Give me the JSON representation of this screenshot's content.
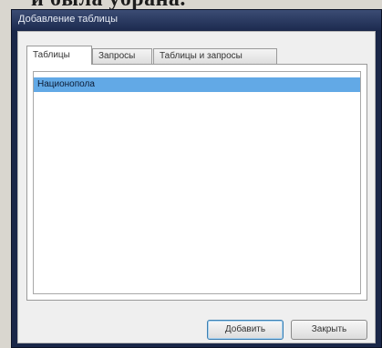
{
  "background_text": "и была убрана.",
  "dialog": {
    "title": "Добавление таблицы",
    "tabs": [
      {
        "label": "Таблицы",
        "active": true
      },
      {
        "label": "Запросы",
        "active": false
      },
      {
        "label": "Таблицы и запросы",
        "active": false
      }
    ],
    "list": {
      "items": [
        {
          "label": "Национопола",
          "selected": true
        }
      ]
    },
    "buttons": {
      "add_label": "Добавить",
      "close_label": "Закрыть"
    }
  },
  "colors": {
    "title_bar": "#1d2b50",
    "selection": "#62a9e6",
    "client_background": "#efefef"
  }
}
